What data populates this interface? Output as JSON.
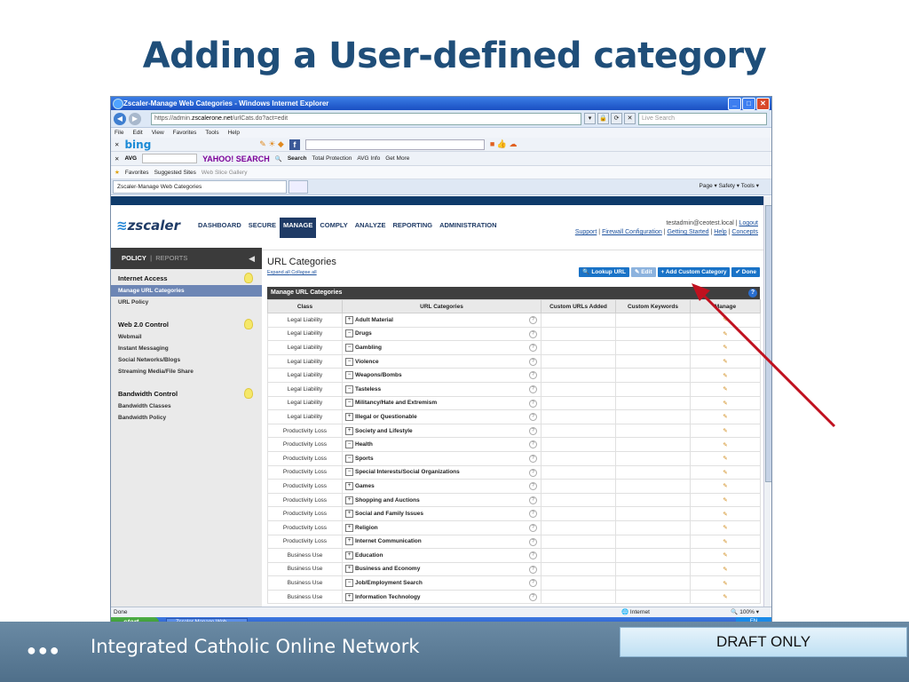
{
  "slide": {
    "title": "Adding a User-defined category",
    "footer_org": "Integrated Catholic Online Network",
    "draft_label": "DRAFT ONLY"
  },
  "browser": {
    "window_title": "Zscaler-Manage Web Categories - Windows Internet Explorer",
    "address_scheme": "https://admin.",
    "address_host": "zscalerone.net",
    "address_path": "/urlCats.do?act=edit",
    "live_search_placeholder": "Live Search",
    "menu": [
      "File",
      "Edit",
      "View",
      "Favorites",
      "Tools",
      "Help"
    ],
    "toolbar_bing": "bing",
    "toolbar_avg": "AVG",
    "toolbar_yahoo": "YAHOO! SEARCH",
    "toolbar_search": "Search",
    "toolbar_total_protection": "Total Protection",
    "toolbar_avg_info": "AVG Info",
    "toolbar_get_more": "Get More",
    "favorites_label": "Favorites",
    "suggested_sites": "Suggested Sites",
    "web_slice_gallery": "Web Slice Gallery",
    "tab_title": "Zscaler-Manage Web Categories",
    "command_bar": "Page ▾  Safety ▾  Tools ▾",
    "status_left": "Done",
    "status_zone": "Internet",
    "status_zoom": "100%",
    "taskbar_start": "start",
    "taskbar_item": "Zscaler-Manage Web ...",
    "tray_lang": "EN"
  },
  "app": {
    "logo": "zscaler",
    "nav": [
      "DASHBOARD",
      "SECURE",
      "MANAGE",
      "COMPLY",
      "ANALYZE",
      "REPORTING",
      "ADMINISTRATION"
    ],
    "active_nav": "MANAGE",
    "user_email": "testadmin@ceotest.local",
    "logout": "Logout",
    "links": [
      "Support",
      "Firewall Configuration",
      "Getting Started",
      "Help",
      "Concepts"
    ],
    "side_tab_policy": "POLICY",
    "side_tab_reports": "REPORTS",
    "sections": [
      {
        "title": "Internet Access",
        "items": [
          "Manage URL Categories",
          "URL Policy"
        ]
      },
      {
        "title": "Web 2.0 Control",
        "items": [
          "Webmail",
          "Instant Messaging",
          "Social Networks/Blogs",
          "Streaming Media/File Share"
        ]
      },
      {
        "title": "Bandwidth Control",
        "items": [
          "Bandwidth Classes",
          "Bandwidth Policy"
        ]
      }
    ],
    "selected_item": "Manage URL Categories",
    "page_title": "URL Categories",
    "expand_all": "Expand all",
    "collapse_all": "Collapse all",
    "buttons": {
      "lookup": "Lookup URL",
      "edit": "Edit",
      "add_custom": "+ Add Custom Category",
      "done": "Done"
    },
    "grid_title": "Manage URL Categories",
    "columns": [
      "Class",
      "URL Categories",
      "Custom URLs Added",
      "Custom Keywords",
      "Manage"
    ],
    "rows": [
      {
        "class": "Legal Liability",
        "category": "Adult Material",
        "expander": "+"
      },
      {
        "class": "Legal Liability",
        "category": "Drugs",
        "expander": "−"
      },
      {
        "class": "Legal Liability",
        "category": "Gambling",
        "expander": "−"
      },
      {
        "class": "Legal Liability",
        "category": "Violence",
        "expander": "−"
      },
      {
        "class": "Legal Liability",
        "category": "Weapons/Bombs",
        "expander": "−"
      },
      {
        "class": "Legal Liability",
        "category": "Tasteless",
        "expander": "−"
      },
      {
        "class": "Legal Liability",
        "category": "Militancy/Hate and Extremism",
        "expander": "−"
      },
      {
        "class": "Legal Liability",
        "category": "Illegal or Questionable",
        "expander": "+"
      },
      {
        "class": "Productivity Loss",
        "category": "Society and Lifestyle",
        "expander": "+"
      },
      {
        "class": "Productivity Loss",
        "category": "Health",
        "expander": "−"
      },
      {
        "class": "Productivity Loss",
        "category": "Sports",
        "expander": "−"
      },
      {
        "class": "Productivity Loss",
        "category": "Special Interests/Social Organizations",
        "expander": "−"
      },
      {
        "class": "Productivity Loss",
        "category": "Games",
        "expander": "+"
      },
      {
        "class": "Productivity Loss",
        "category": "Shopping and Auctions",
        "expander": "+"
      },
      {
        "class": "Productivity Loss",
        "category": "Social and Family Issues",
        "expander": "+"
      },
      {
        "class": "Productivity Loss",
        "category": "Religion",
        "expander": "+"
      },
      {
        "class": "Productivity Loss",
        "category": "Internet Communication",
        "expander": "+"
      },
      {
        "class": "Business Use",
        "category": "Education",
        "expander": "+"
      },
      {
        "class": "Business Use",
        "category": "Business and Economy",
        "expander": "+"
      },
      {
        "class": "Business Use",
        "category": "Job/Employment Search",
        "expander": "−"
      },
      {
        "class": "Business Use",
        "category": "Information Technology",
        "expander": "+"
      }
    ]
  },
  "colors": {
    "title": "#1f4e79",
    "arrow": "#c0111f",
    "zscaler_navy": "#1f3b66",
    "button_blue": "#1a73c7"
  }
}
